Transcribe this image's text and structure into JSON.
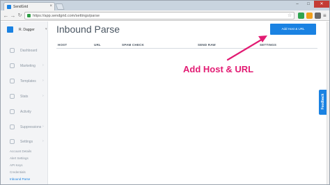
{
  "browser": {
    "tab_title": "SendGrid",
    "tab_close": "×",
    "url": "https://app.sendgrid.com/settings/parse",
    "window_controls": {
      "minimize": "–",
      "maximize": "□",
      "close": "✕"
    },
    "nav": {
      "back": "←",
      "forward": "→",
      "reload": "↻"
    },
    "star": "☆",
    "menu": "≡"
  },
  "sidebar": {
    "account_name": "R. Dagger",
    "account_caret": "▾",
    "items": [
      {
        "label": "Dashboard",
        "icon": "dashboard-icon",
        "chevron": ""
      },
      {
        "label": "Marketing",
        "icon": "marketing-icon",
        "chevron": "›"
      },
      {
        "label": "Templates",
        "icon": "templates-icon",
        "chevron": "›"
      },
      {
        "label": "Stats",
        "icon": "stats-icon",
        "chevron": "›"
      },
      {
        "label": "Activity",
        "icon": "activity-icon",
        "chevron": ""
      },
      {
        "label": "Suppressions",
        "icon": "suppressions-icon",
        "chevron": "›"
      },
      {
        "label": "Settings",
        "icon": "settings-icon",
        "chevron": "›"
      }
    ],
    "sub_items": [
      {
        "label": "Account Details"
      },
      {
        "label": "Alert Settings"
      },
      {
        "label": "API Keys"
      },
      {
        "label": "Credentials"
      },
      {
        "label": "Inbound Parse"
      }
    ]
  },
  "main": {
    "page_title": "Inbound Parse",
    "add_button_label": "Add Host & URL",
    "table_headers": [
      "HOST",
      "URL",
      "SPAM CHECK",
      "SEND RAW",
      "SETTINGS"
    ]
  },
  "annotation": {
    "text": "Add Host & URL",
    "color": "#e21b73"
  },
  "feedback_label": "Feedback",
  "colors": {
    "accent": "#1a82e2",
    "annotation": "#e21b73"
  }
}
